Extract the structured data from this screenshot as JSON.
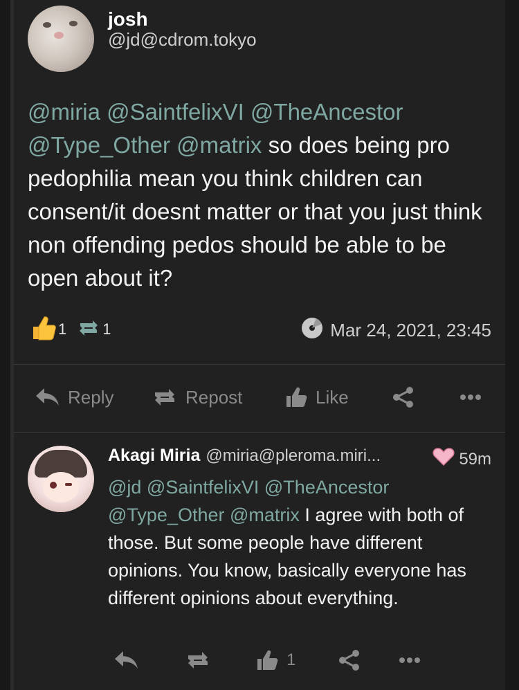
{
  "post": {
    "author_name": "josh",
    "author_handle": "@jd@cdrom.tokyo",
    "mentions_line1": "@miria @SaintfelixVI @TheAncestor",
    "mentions_line2a": "@Type_Other @matrix",
    "text_after_mentions": " so does being pro pedophilia mean you think children can consent/it doesnt matter or that you just think non offending pedos should be able to be open about it?",
    "like_count": "1",
    "repost_count": "1",
    "timestamp": "Mar 24, 2021, 23:45"
  },
  "actions": {
    "reply": "Reply",
    "repost": "Repost",
    "like": "Like"
  },
  "reply": {
    "author_name": "Akagi Miria",
    "author_handle": "@miria@pleroma.miri...",
    "time": "59m",
    "mentions_line1": "@jd @SaintfelixVI @TheAncestor",
    "mentions_line2": "@Type_Other @matrix",
    "text_after_mentions": " I agree with both of those. But some people have different opinions. You know, basically everyone has different opinions about everything.",
    "like_count": "1"
  },
  "icons": {
    "like_reaction": "thumbs-up-emoji-icon",
    "repost": "repost-icon",
    "visibility": "globe-disc-icon",
    "reply": "reply-icon",
    "like": "thumbs-up-icon",
    "share": "share-icon",
    "more": "more-icon",
    "badge": "heart-badge-icon"
  },
  "colors": {
    "mention": "#7fa8a2",
    "background": "#212121",
    "muted": "#8a8a8a"
  }
}
